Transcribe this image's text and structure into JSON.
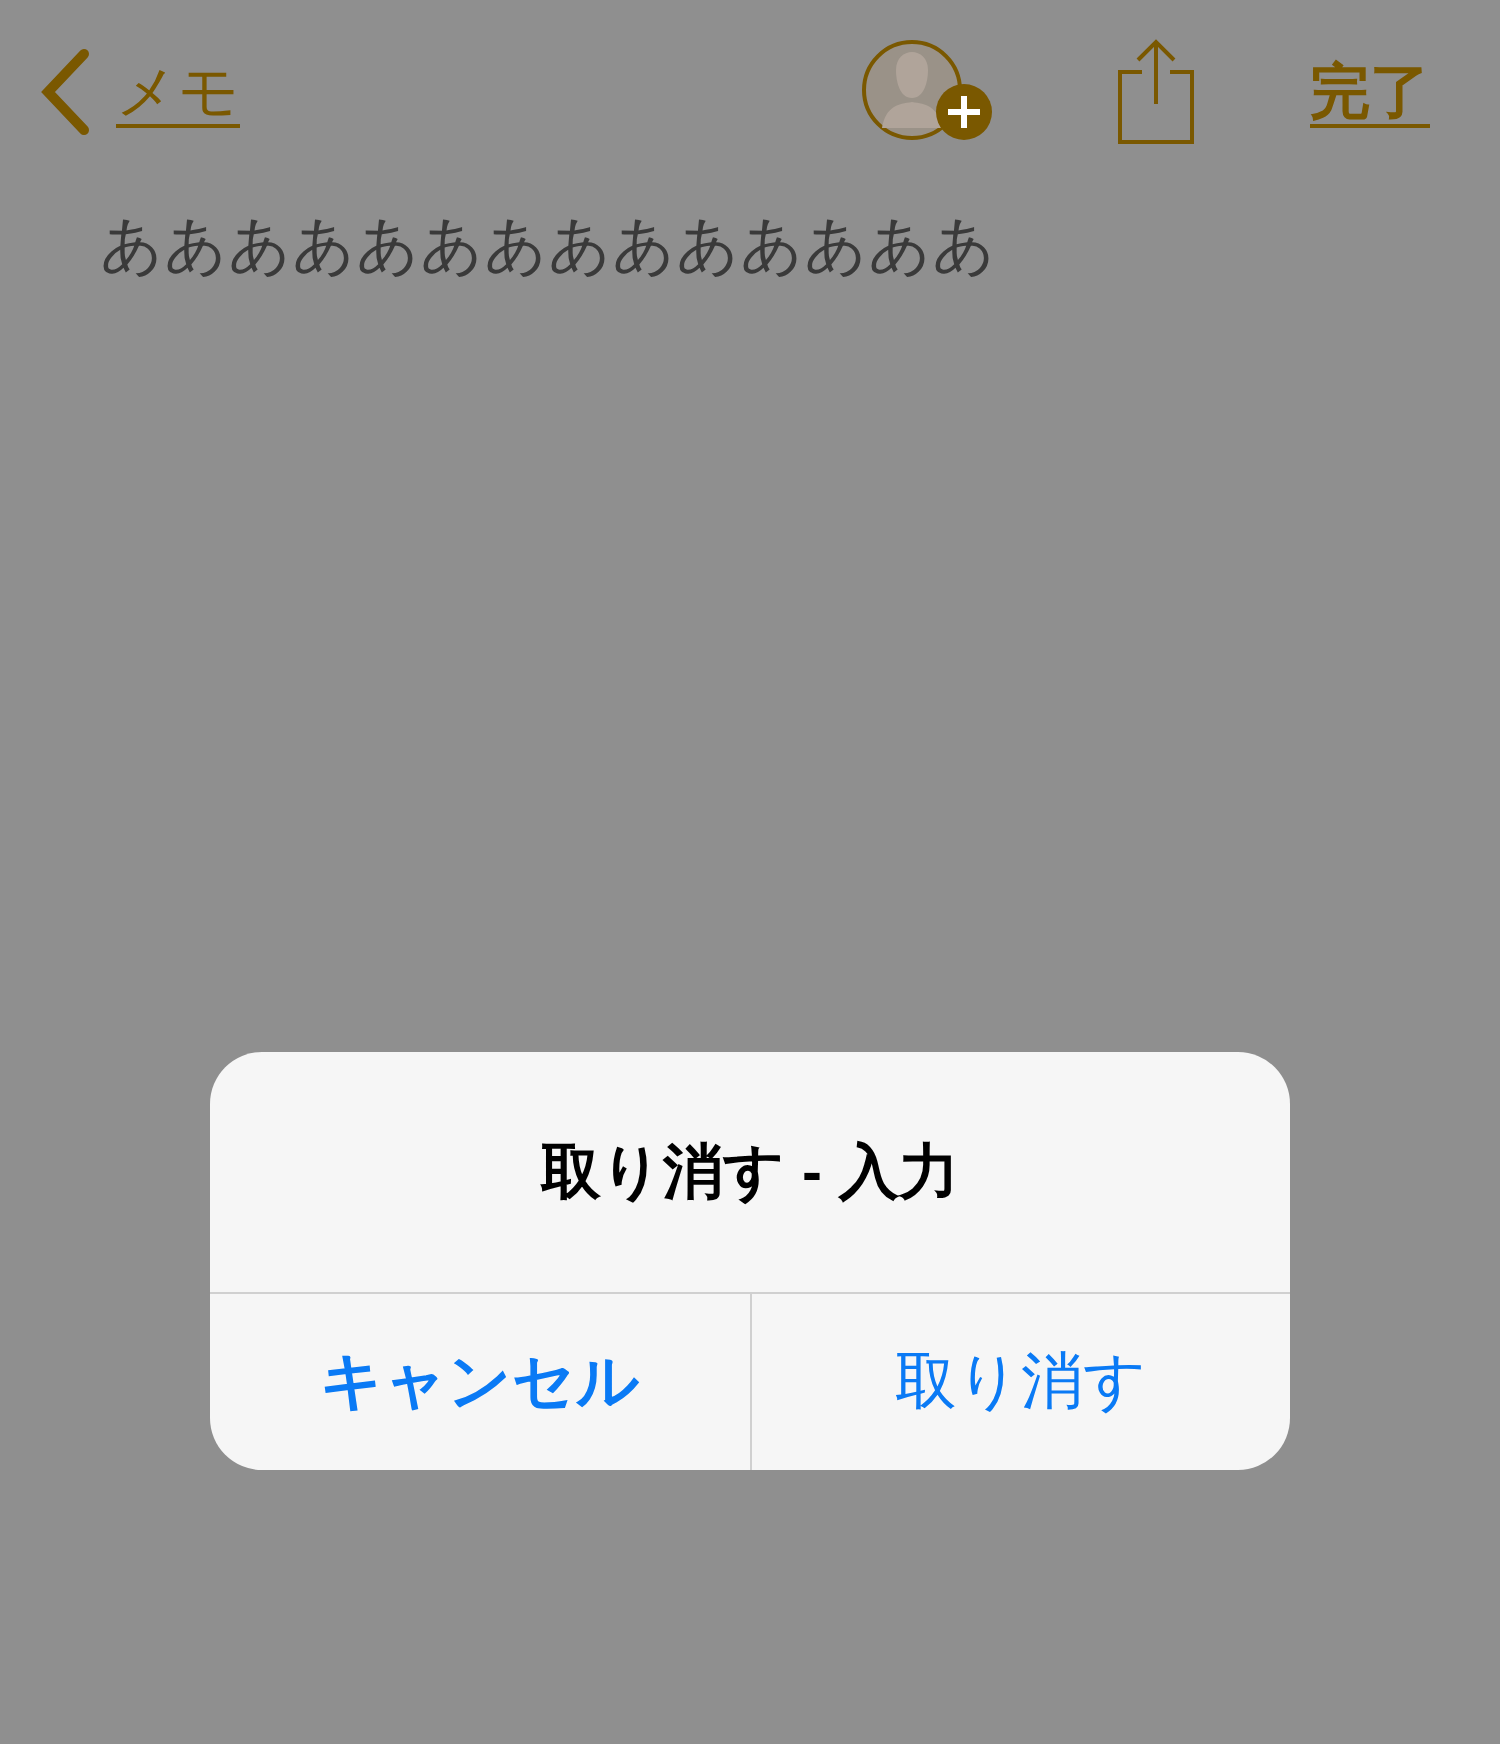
{
  "nav": {
    "back_label": "メモ",
    "done_label": "完了"
  },
  "note": {
    "text": "ああああああああああああああ"
  },
  "alert": {
    "title": "取り消す - 入力",
    "buttons": [
      {
        "label": "キャンセル",
        "kind": "cancel"
      },
      {
        "label": "取り消す",
        "kind": "default"
      }
    ]
  }
}
